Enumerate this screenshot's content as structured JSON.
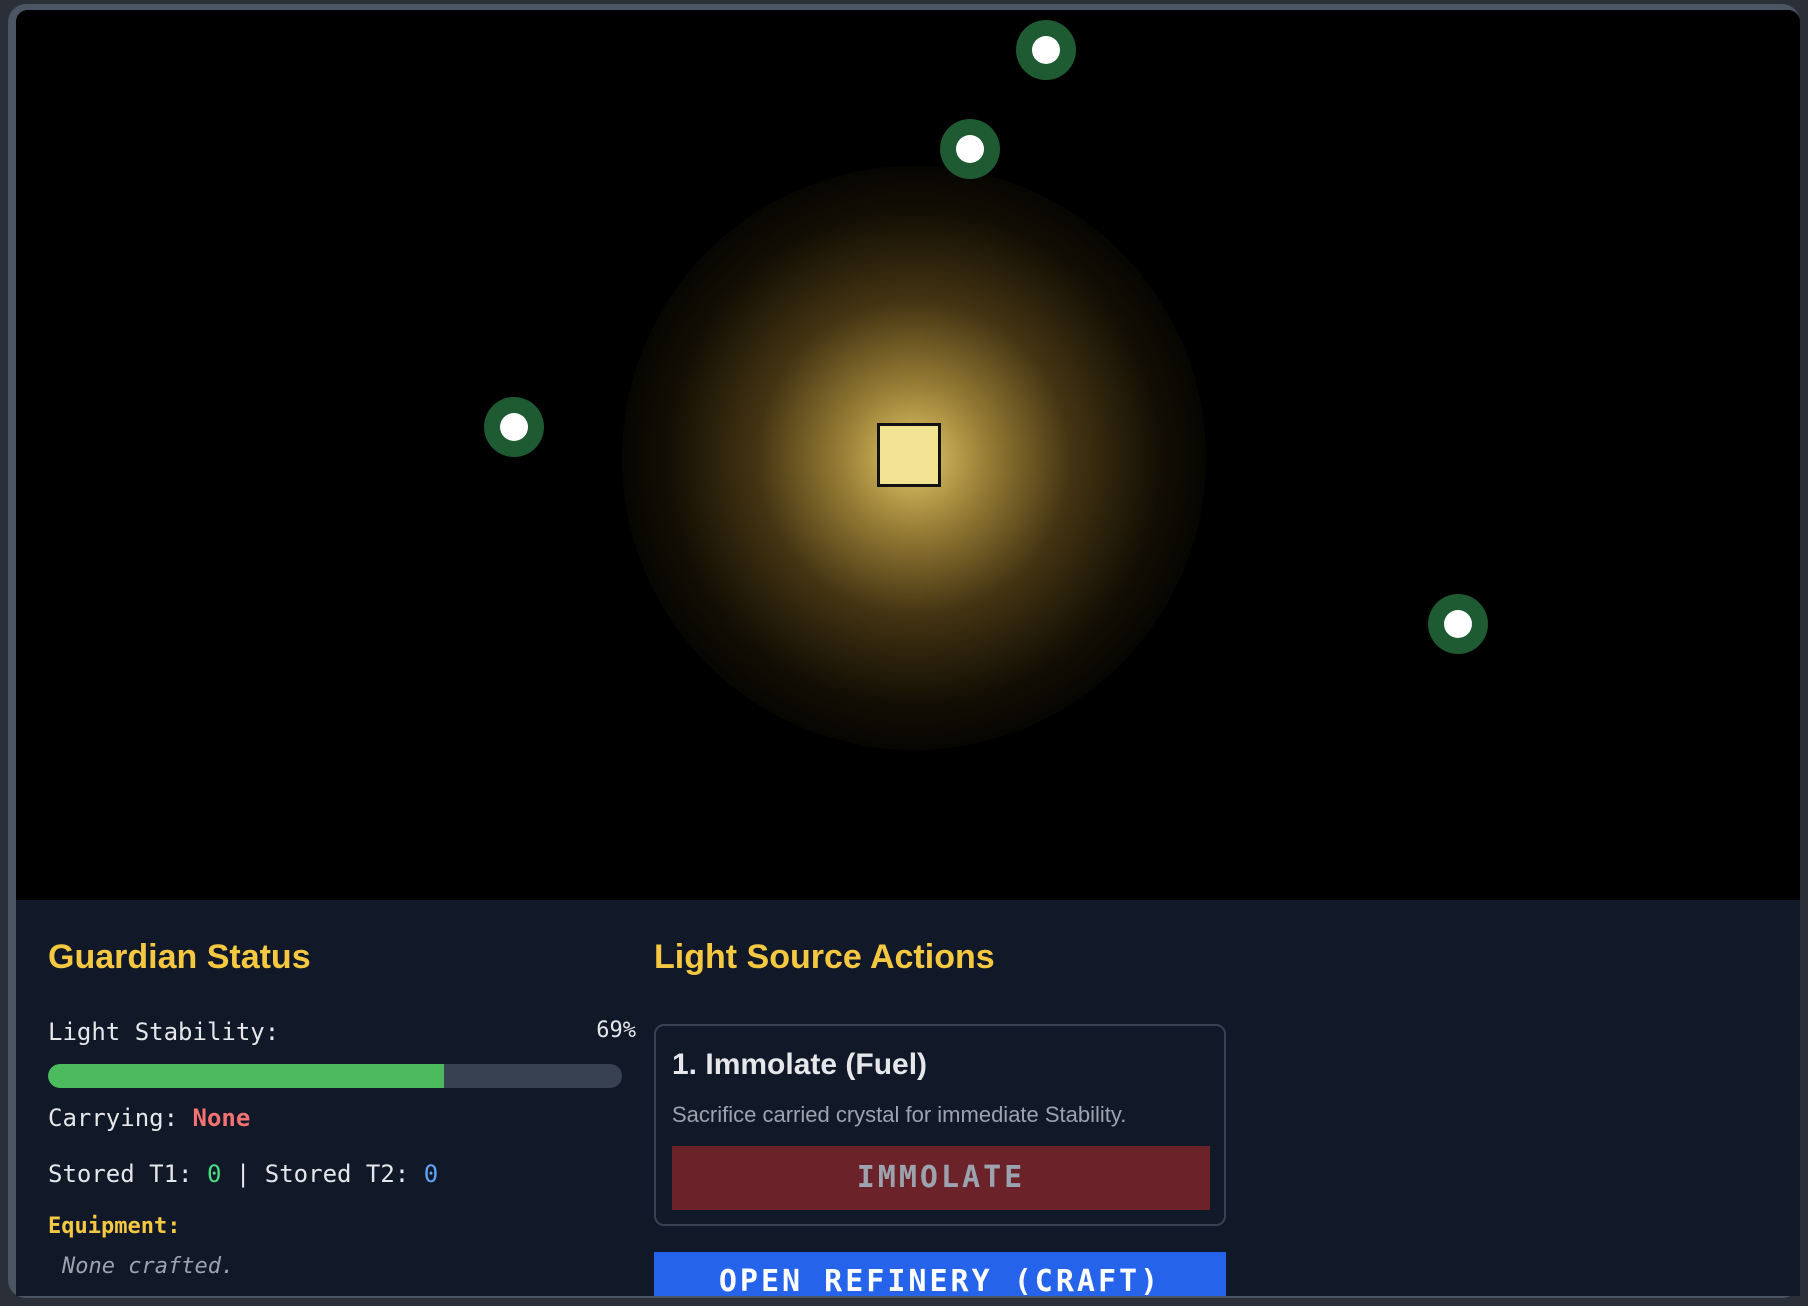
{
  "colors": {
    "accent": "#f5c842",
    "panel_bg": "#111827",
    "crystal_ring": "#1e5a32",
    "stability_bar": "#4cbb5e",
    "danger": "#f47272",
    "immolate_bg": "#6b2228",
    "refinery_bg": "#2563eb"
  },
  "status": {
    "title": "Guardian Status",
    "stability_label": "Light Stability:",
    "stability_value": "69%",
    "stability_fraction": 0.69,
    "carrying_label": "Carrying:",
    "carrying_value": "None",
    "stored_t1_label": "Stored T1:",
    "stored_t1_value": "0",
    "separator": "|",
    "stored_t2_label": "Stored T2:",
    "stored_t2_value": "0",
    "equipment_label": "Equipment:",
    "equipment_value": "None crafted."
  },
  "actions": {
    "title": "Light Source Actions",
    "immolate": {
      "title": "1. Immolate (Fuel)",
      "description": "Sacrifice carried crystal for immediate Stability.",
      "button_label": "IMMOLATE"
    },
    "refinery_button_label": "OPEN REFINERY (CRAFT)"
  },
  "scene": {
    "light_source_icon": "square-core",
    "crystal_icon": "ring-crystal",
    "crystal_count": 4
  }
}
